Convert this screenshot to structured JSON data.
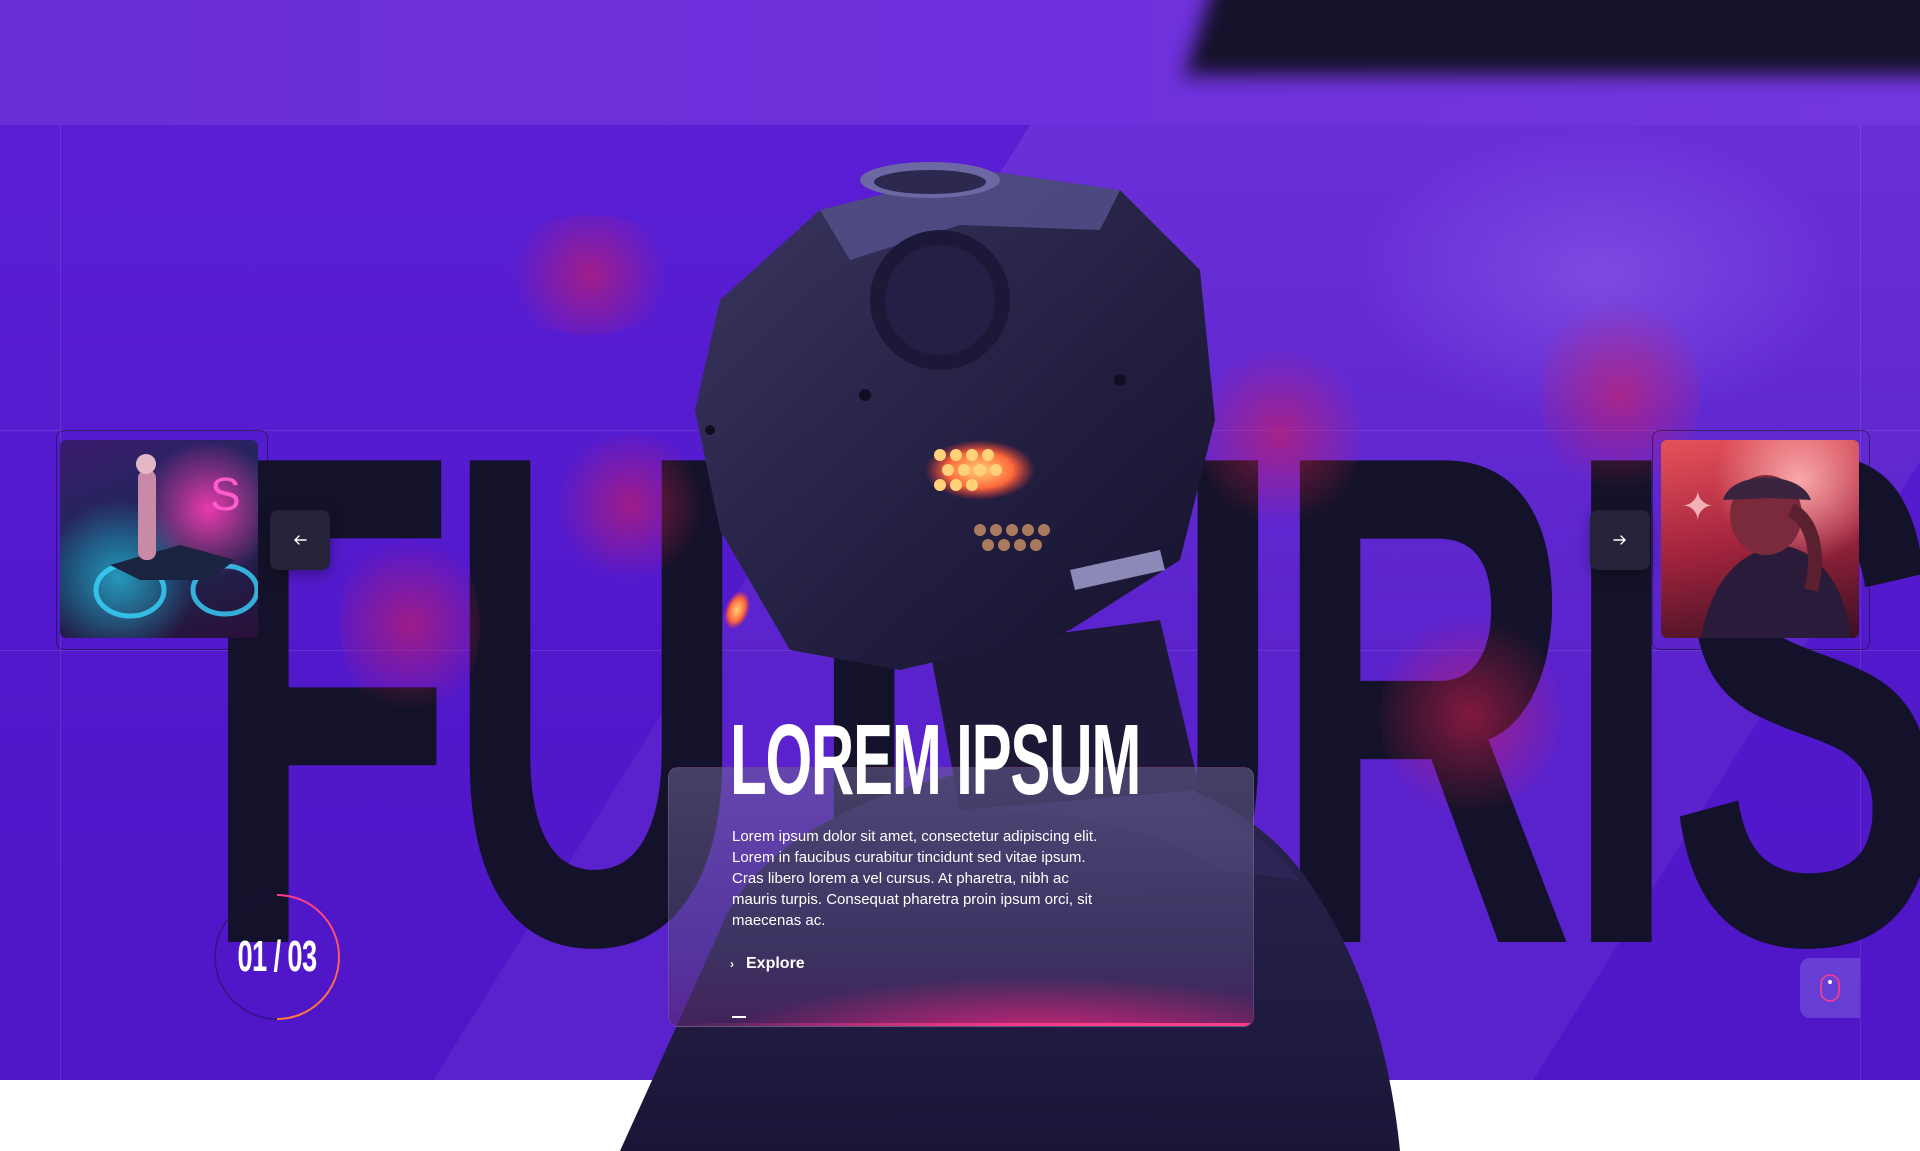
{
  "hero": {
    "background_word": "FUTURISTIC",
    "headline": "LOREM IPSUM",
    "description": "Lorem ipsum dolor sit amet, consectetur adipiscing elit. Lorem in faucibus curabitur tincidunt sed vitae ipsum. Cras libero lorem a vel cursus. At pharetra, nibh ac mauris turpis. Consequat pharetra proin ipsum orci, sit maecenas ac.",
    "cta_label": "Explore"
  },
  "slider": {
    "counter": "01 / 03",
    "prev_icon": "arrow-left-icon",
    "next_icon": "arrow-right-icon",
    "progress": 0.33
  },
  "scroll_hint": {
    "icon": "mouse-icon"
  },
  "colors": {
    "primary_purple": "#5219cc",
    "dark_text": "#14122a",
    "accent_pink": "#ff3c8a",
    "nav_button": "#262239"
  }
}
